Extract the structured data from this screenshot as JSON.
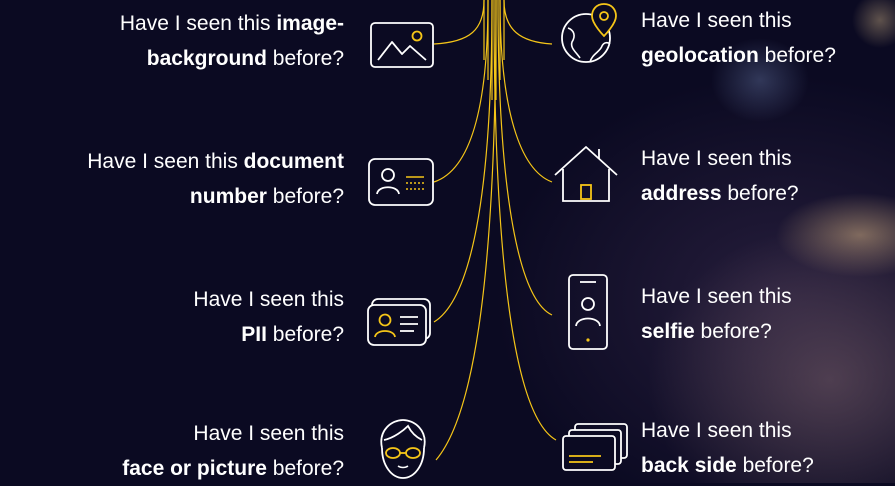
{
  "colors": {
    "accent": "#f5c518",
    "background": "#0b0a22",
    "text": "#ffffff"
  },
  "left_items": [
    {
      "icon": "image-icon",
      "prefix": "Have I seen this ",
      "bold": "image-",
      "line2_bold": "background",
      "suffix": " before?"
    },
    {
      "icon": "id-card-icon",
      "prefix": "Have I seen this ",
      "bold": "document",
      "line2_bold": "number",
      "suffix": " before?"
    },
    {
      "icon": "pii-card-icon",
      "prefix": "Have I seen this",
      "bold": "",
      "line2_bold": "PII",
      "suffix": " before?"
    },
    {
      "icon": "face-glasses-icon",
      "prefix": "Have I seen this",
      "bold": "",
      "line2_bold": "face or picture",
      "suffix": " before?"
    }
  ],
  "right_items": [
    {
      "icon": "globe-pin-icon",
      "line1": "Have I seen this",
      "bold": "geolocation",
      "suffix": " before?"
    },
    {
      "icon": "house-icon",
      "line1": "Have I seen this",
      "bold": "address",
      "suffix": " before?"
    },
    {
      "icon": "phone-selfie-icon",
      "line1": "Have I seen this",
      "bold": "selfie",
      "suffix": " before?"
    },
    {
      "icon": "cards-stack-icon",
      "line1": "Have I seen this",
      "bold": "back side",
      "suffix": " before?"
    }
  ]
}
